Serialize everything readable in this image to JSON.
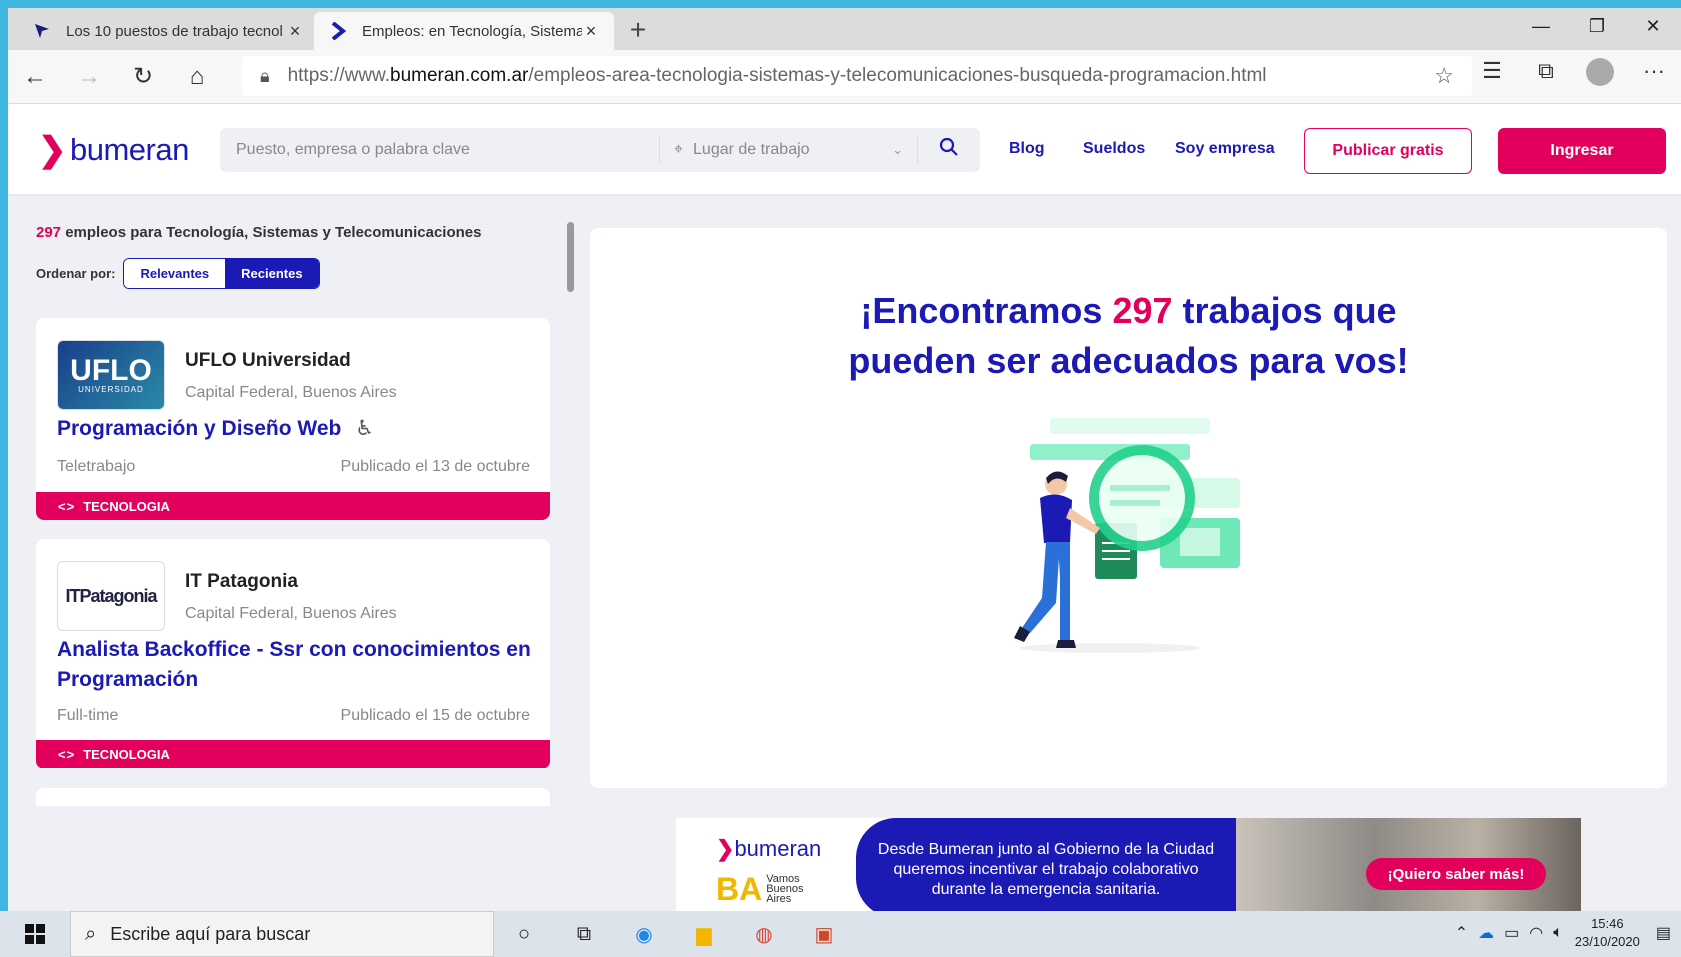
{
  "browser": {
    "tabs": [
      {
        "title": "Los 10 puestos de trabajo tecnol",
        "active": false
      },
      {
        "title": "Empleos: en Tecnología, Sistemas",
        "active": true
      }
    ],
    "new_tab": "+",
    "url_prefix": "https://www.",
    "url_domain": "bumeran.com.ar",
    "url_path": "/empleos-area-tecnologia-sistemas-y-telecomunicaciones-busqueda-programacion.html"
  },
  "header": {
    "logo": "bumeran",
    "search_placeholder": "Puesto, empresa o palabra clave",
    "location_placeholder": "Lugar de trabajo",
    "links": [
      "Blog",
      "Sueldos",
      "Soy empresa"
    ],
    "publish_label": "Publicar gratis",
    "login_label": "Ingresar"
  },
  "results": {
    "count": "297",
    "count_text": " empleos para Tecnología, Sistemas y Telecomunicaciones",
    "sort_label": "Ordenar por:",
    "sort_options": [
      "Relevantes",
      "Recientes"
    ],
    "sort_selected": "Recientes"
  },
  "jobs": [
    {
      "company": "UFLO Universidad",
      "logo_text": "UFLO",
      "logo_sub": "UNIVERSIDAD",
      "location": "Capital Federal, Buenos Aires",
      "title": "Programación y Diseño Web",
      "modality": "Teletrabajo",
      "published": "Publicado el 13 de octubre",
      "tag": "TECNOLOGIA",
      "accessible": true
    },
    {
      "company": "IT Patagonia",
      "logo_text": "ITPatagonia",
      "location": "Capital Federal, Buenos Aires",
      "title_line1": "Analista Backoffice - Ssr con conocimientos en",
      "title_line2": "Programación",
      "modality": "Full-time",
      "published": "Publicado el 15 de octubre",
      "tag": "TECNOLOGIA"
    }
  ],
  "panel": {
    "headline_pre": "¡Encontramos ",
    "headline_count": "297",
    "headline_post": " trabajos que",
    "headline_line2": "pueden ser adecuados para vos!"
  },
  "banner": {
    "logo": "bumeran",
    "ba_text": "BA",
    "ba_sub": [
      "Vamos",
      "Buenos",
      "Aires"
    ],
    "text": "Desde Bumeran junto al Gobierno de la Ciudad queremos incentivar el trabajo colaborativo durante la emergencia sanitaria.",
    "cta": "¡Quiero saber más!"
  },
  "taskbar": {
    "search_placeholder": "Escribe aquí para buscar",
    "time": "15:46",
    "date": "23/10/2020"
  },
  "colors": {
    "brand_blue": "#1c1ab4",
    "brand_pink": "#e3005d"
  }
}
